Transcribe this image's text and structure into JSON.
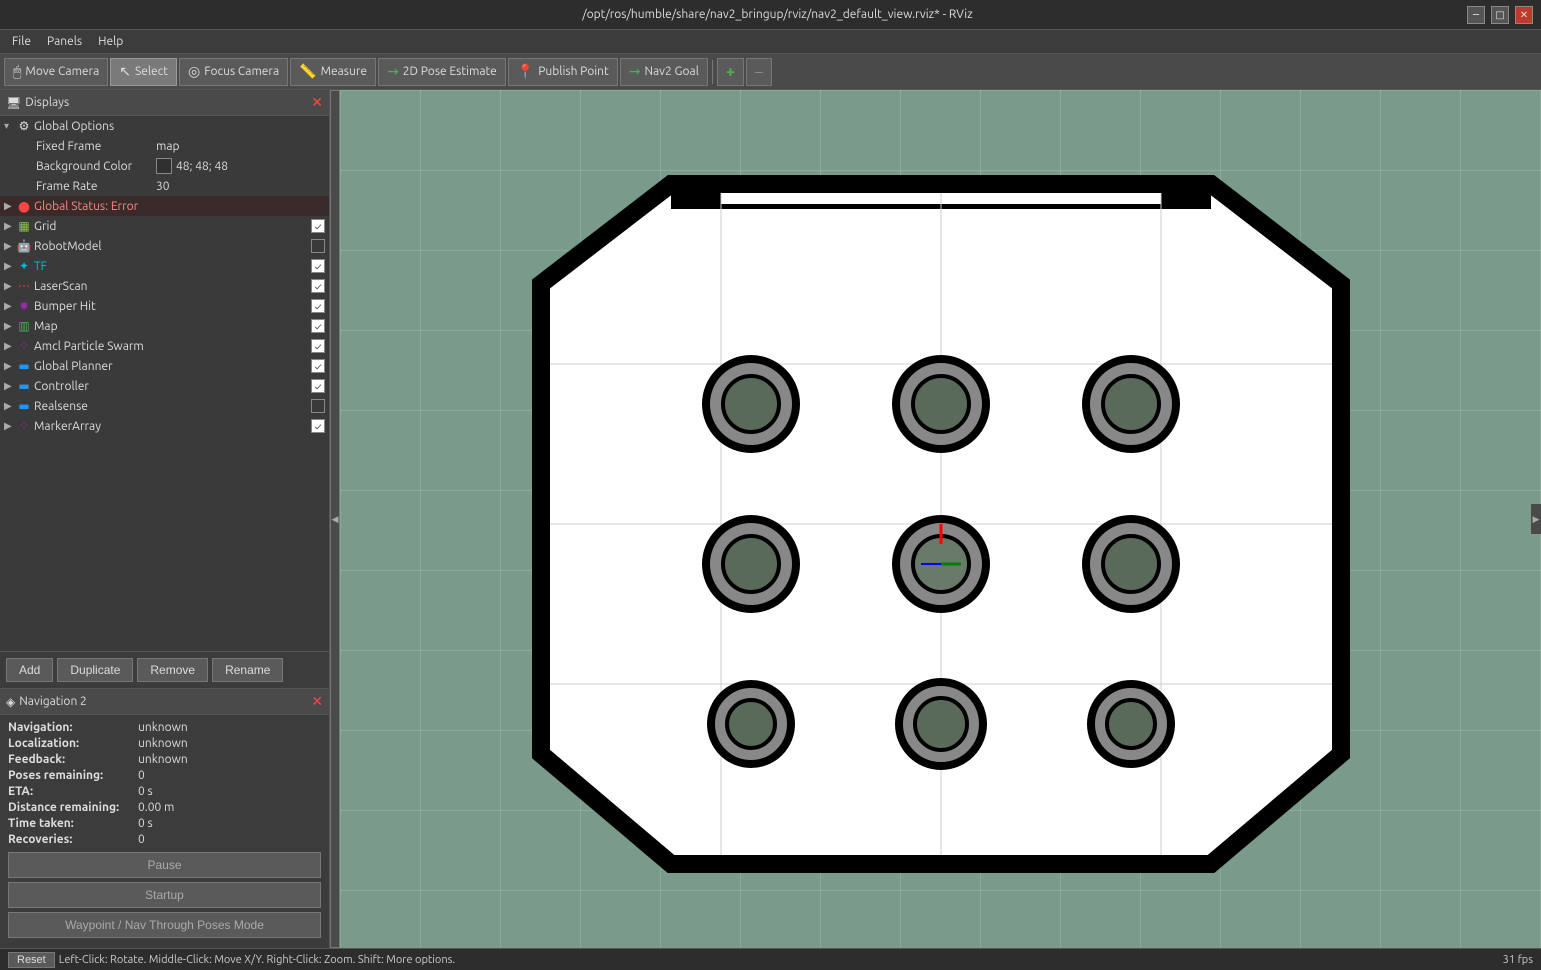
{
  "titlebar": {
    "title": "/opt/ros/humble/share/nav2_bringup/rviz/nav2_default_view.rviz* - RViz",
    "minimize": "─",
    "maximize": "□",
    "close": "✕"
  },
  "menubar": {
    "items": [
      "File",
      "Panels",
      "Help"
    ]
  },
  "toolbar": {
    "buttons": [
      {
        "label": "Move Camera",
        "icon": "🖱",
        "active": false
      },
      {
        "label": "Select",
        "icon": "↖",
        "active": true
      },
      {
        "label": "Focus Camera",
        "icon": "◎",
        "active": false
      },
      {
        "label": "Measure",
        "icon": "📏",
        "active": false
      },
      {
        "label": "2D Pose Estimate",
        "icon": "→",
        "active": false
      },
      {
        "label": "Publish Point",
        "icon": "📍",
        "active": false
      },
      {
        "label": "Nav2 Goal",
        "icon": "→",
        "active": false
      }
    ],
    "plus_tooltip": "Add",
    "minus_tooltip": "Remove"
  },
  "displays": {
    "panel_title": "Displays",
    "items": [
      {
        "type": "group",
        "label": "Global Options",
        "expanded": true,
        "icon": "gear",
        "children": [
          {
            "label": "Fixed Frame",
            "value": "map"
          },
          {
            "label": "Background Color",
            "value": "48; 48; 48",
            "has_swatch": true
          },
          {
            "label": "Frame Rate",
            "value": "30"
          }
        ]
      },
      {
        "label": "Global Status: Error",
        "icon": "error",
        "checked": null,
        "indent": 0
      },
      {
        "label": "Grid",
        "icon": "grid",
        "checked": true,
        "indent": 0
      },
      {
        "label": "RobotModel",
        "icon": "robot",
        "checked": false,
        "indent": 0
      },
      {
        "label": "TF",
        "icon": "tf",
        "checked": true,
        "indent": 0
      },
      {
        "label": "LaserScan",
        "icon": "laser",
        "checked": true,
        "indent": 0
      },
      {
        "label": "Bumper Hit",
        "icon": "bumper",
        "checked": true,
        "indent": 0
      },
      {
        "label": "Map",
        "icon": "map",
        "checked": true,
        "indent": 0
      },
      {
        "label": "Amcl Particle Swarm",
        "icon": "particles",
        "checked": true,
        "indent": 0
      },
      {
        "label": "Global Planner",
        "icon": "planner",
        "checked": true,
        "indent": 0
      },
      {
        "label": "Controller",
        "icon": "controller",
        "checked": true,
        "indent": 0
      },
      {
        "label": "Realsense",
        "icon": "camera",
        "checked": false,
        "indent": 0
      },
      {
        "label": "MarkerArray",
        "icon": "markers",
        "checked": true,
        "indent": 0
      }
    ],
    "buttons": [
      "Add",
      "Duplicate",
      "Remove",
      "Rename"
    ]
  },
  "navigation": {
    "panel_title": "Navigation 2",
    "rows": [
      {
        "label": "Navigation:",
        "value": "unknown"
      },
      {
        "label": "Localization:",
        "value": "unknown"
      },
      {
        "label": "Feedback:",
        "value": "unknown"
      },
      {
        "label": "Poses remaining:",
        "value": "0"
      },
      {
        "label": "ETA:",
        "value": "0 s"
      },
      {
        "label": "Distance remaining:",
        "value": "0.00 m"
      },
      {
        "label": "Time taken:",
        "value": "0 s"
      },
      {
        "label": "Recoveries:",
        "value": "0"
      }
    ],
    "buttons": [
      "Pause",
      "Startup",
      "Waypoint / Nav Through Poses Mode"
    ]
  },
  "statusbar": {
    "reset": "Reset",
    "hint": "Left-Click: Rotate.  Middle-Click: Move X/Y.  Right-Click: Zoom.  Shift: More options.",
    "fps": "31 fps"
  }
}
